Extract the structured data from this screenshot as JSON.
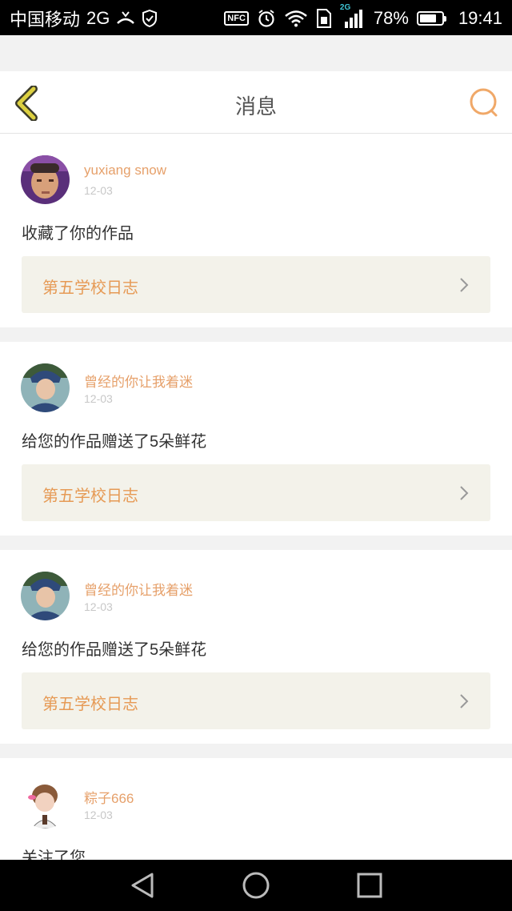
{
  "status_bar": {
    "carrier": "中国移动",
    "network": "2G",
    "signal_tag": "2G",
    "nfc": "NFC",
    "battery": "78%",
    "battery_level": 0.78,
    "time": "19:41"
  },
  "header": {
    "title": "消息",
    "back_icon": "chevron-left-icon",
    "search_icon": "search-icon"
  },
  "messages": [
    {
      "user": "yuxiang snow",
      "date": "12-03",
      "action": "收藏了你的作品",
      "work": "第五学校日志"
    },
    {
      "user": "曾经的你让我着迷",
      "date": "12-03",
      "action": "给您的作品赠送了5朵鲜花",
      "work": "第五学校日志"
    },
    {
      "user": "曾经的你让我着迷",
      "date": "12-03",
      "action": "给您的作品赠送了5朵鲜花",
      "work": "第五学校日志"
    },
    {
      "user": "粽子666",
      "date": "12-03",
      "action": "关注了您",
      "work": ""
    }
  ],
  "colors": {
    "accent": "#f0a868",
    "username": "#e6a06a",
    "back_arrow": "#d4c93a",
    "link_bg": "#f3f2ea"
  }
}
